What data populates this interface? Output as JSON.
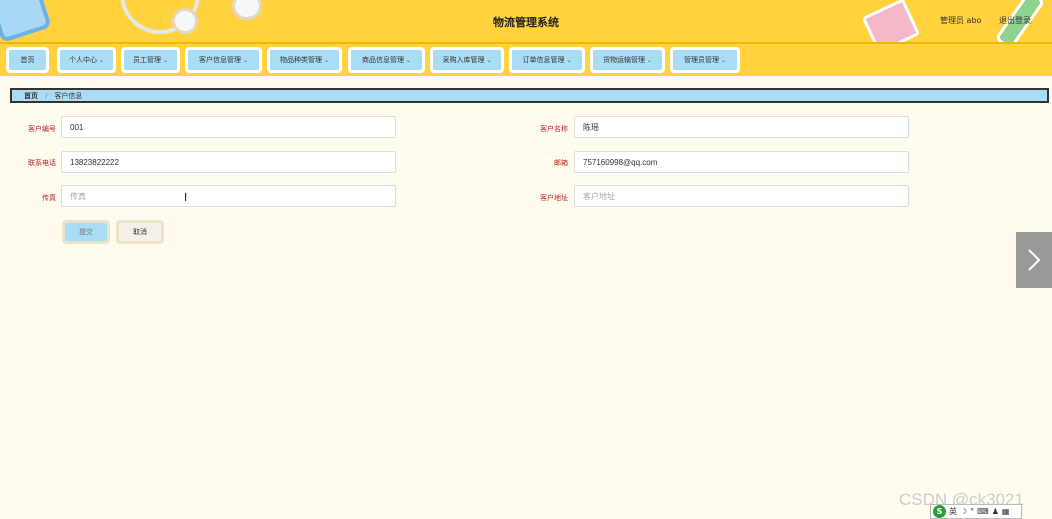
{
  "header": {
    "title": "物流管理系统",
    "user_label": "管理员 abo",
    "logout_label": "退出登录"
  },
  "nav": {
    "items": [
      {
        "label": "首页",
        "dropdown": false
      },
      {
        "label": "个人中心",
        "dropdown": true
      },
      {
        "label": "员工管理",
        "dropdown": true
      },
      {
        "label": "客户信息管理",
        "dropdown": true
      },
      {
        "label": "物品种类管理",
        "dropdown": true
      },
      {
        "label": "商品信息管理",
        "dropdown": true
      },
      {
        "label": "采购入库管理",
        "dropdown": true
      },
      {
        "label": "订单信息管理",
        "dropdown": true
      },
      {
        "label": "货物运输管理",
        "dropdown": true
      },
      {
        "label": "管理员管理",
        "dropdown": true
      }
    ],
    "chevron": "⌄"
  },
  "breadcrumb": {
    "home": "首页",
    "current": "客户信息"
  },
  "form": {
    "customer_no_label": "客户编号",
    "customer_no_value": "001",
    "customer_name_label": "客户名称",
    "customer_name_value": "陈瑶",
    "phone_label": "联系电话",
    "phone_value": "13823822222",
    "email_label": "邮箱",
    "email_value": "757160998@qq.com",
    "fax_label": "传真",
    "fax_placeholder": "传真",
    "address_label": "客户地址",
    "address_placeholder": "客户地址",
    "submit_label": "提交",
    "cancel_label": "取消"
  },
  "watermark": "CSDN @ck3021",
  "ime": {
    "logo": "S",
    "lang": "英",
    "glyphs": [
      "☽",
      "°",
      "⌨",
      "♟",
      "▦"
    ]
  },
  "colors": {
    "header_bg": "#ffd23e",
    "nav_button_bg": "#a9dcf5",
    "label_red": "#b22222",
    "page_bg": "#fffbee"
  }
}
